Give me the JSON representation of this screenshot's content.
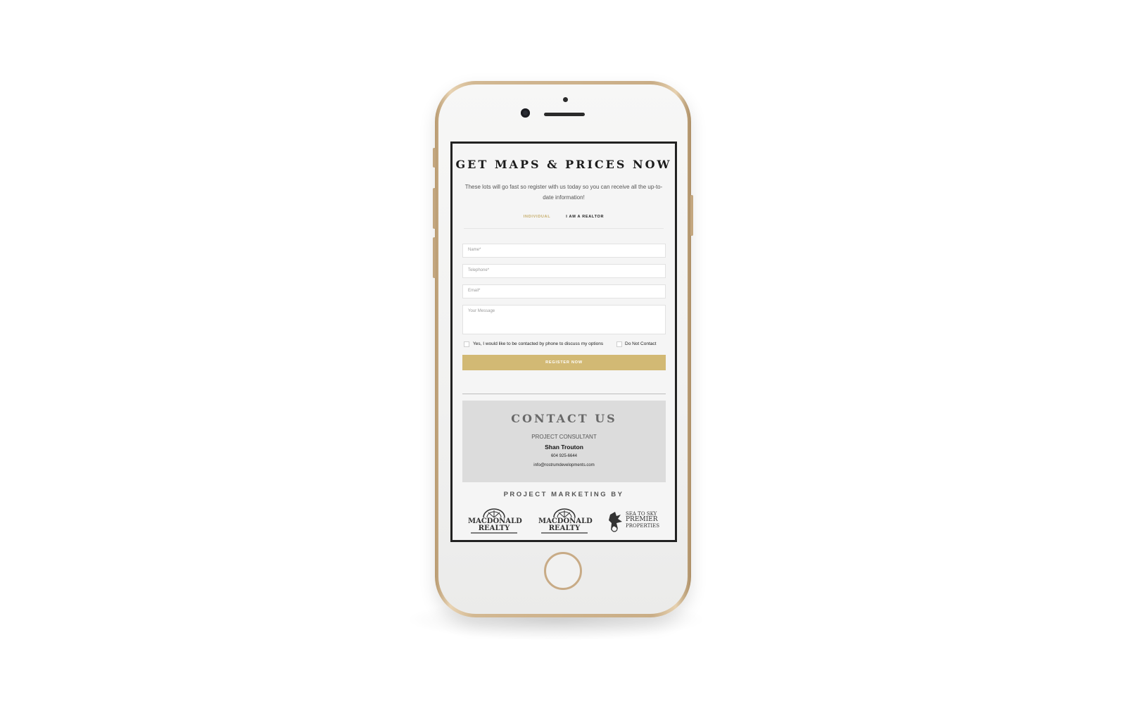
{
  "form": {
    "title": "GET MAPS & PRICES NOW",
    "subtitle": "These lots will go fast so register with us today so you can receive all the up-to-date information!",
    "tabs": [
      {
        "label": "INDIVIDUAL",
        "active": true
      },
      {
        "label": "I AM A REALTOR",
        "active": false
      }
    ],
    "fields": {
      "name_placeholder": "Name*",
      "telephone_placeholder": "Telephone*",
      "email_placeholder": "Email*",
      "message_placeholder": "Your Message"
    },
    "checkbox_contact_label": "Yes, I would like to be contacted by phone to discuss my options",
    "checkbox_do_not_contact_label": "Do Not Contact",
    "register_label": "REGISTER NOW"
  },
  "contact": {
    "title": "CONTACT US",
    "role": "PROJECT CONSULTANT",
    "name": "Shan Trouton",
    "phone": "604 925-6644",
    "email": "info@rostrumdevelopments.com"
  },
  "marketing": {
    "title": "PROJECT MARKETING BY",
    "logos": [
      {
        "line1": "MACDONALD",
        "line2": "REALTY"
      },
      {
        "line1": "MACDONALD",
        "line2": "REALTY"
      },
      {
        "line1": "SEA TO SKY",
        "line2": "PREMIER",
        "line3": "PROPERTIES"
      }
    ]
  },
  "colors": {
    "accent": "#d2b974",
    "phone_frame": "#c9ad86",
    "contact_bg": "#dcdcdc"
  }
}
